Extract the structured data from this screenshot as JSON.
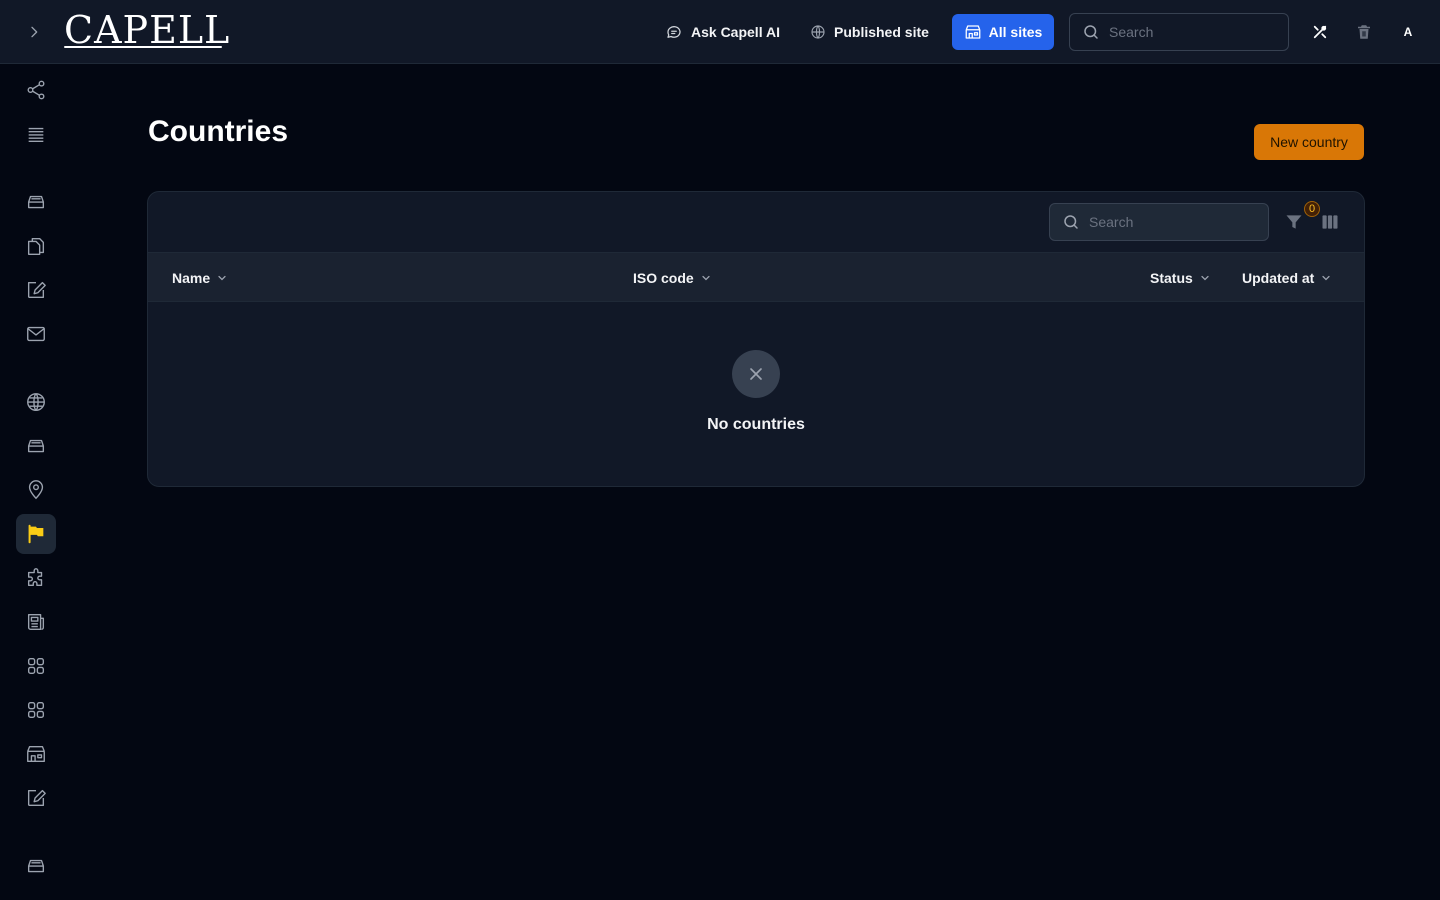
{
  "header": {
    "logo_text": "CAPELL",
    "ask_ai_label": "Ask Capell AI",
    "published_site_label": "Published site",
    "all_sites_label": "All sites",
    "search_placeholder": "Search",
    "avatar_initial": "A"
  },
  "sidebar": {
    "items": [
      {
        "icon": "share-icon",
        "active": false
      },
      {
        "icon": "list-icon",
        "active": false
      },
      {
        "icon": "inbox-stack-icon",
        "active": false
      },
      {
        "icon": "documents-icon",
        "active": false
      },
      {
        "icon": "edit-square-icon",
        "active": false
      },
      {
        "icon": "mail-icon",
        "active": false
      },
      {
        "icon": "globe-icon",
        "active": false
      },
      {
        "icon": "inbox-stack-icon",
        "active": false
      },
      {
        "icon": "map-pin-icon",
        "active": false
      },
      {
        "icon": "flag-icon",
        "active": true
      },
      {
        "icon": "puzzle-icon",
        "active": false
      },
      {
        "icon": "newspaper-icon",
        "active": false
      },
      {
        "icon": "grid-icon",
        "active": false
      },
      {
        "icon": "grid-icon",
        "active": false
      },
      {
        "icon": "store-icon",
        "active": false
      },
      {
        "icon": "edit-square-icon",
        "active": false
      },
      {
        "icon": "inbox-stack-icon",
        "active": false
      }
    ]
  },
  "main": {
    "title": "Countries",
    "new_button_label": "New country",
    "table": {
      "search_placeholder": "Search",
      "filter_count": "0",
      "columns": [
        "Name",
        "ISO code",
        "Status",
        "Updated at"
      ],
      "rows": [],
      "empty_message": "No countries"
    }
  },
  "colors": {
    "accent": "#d97706",
    "active_icon": "#facc15",
    "primary_button": "#2563eb",
    "background": "#030712",
    "surface": "#111827"
  }
}
